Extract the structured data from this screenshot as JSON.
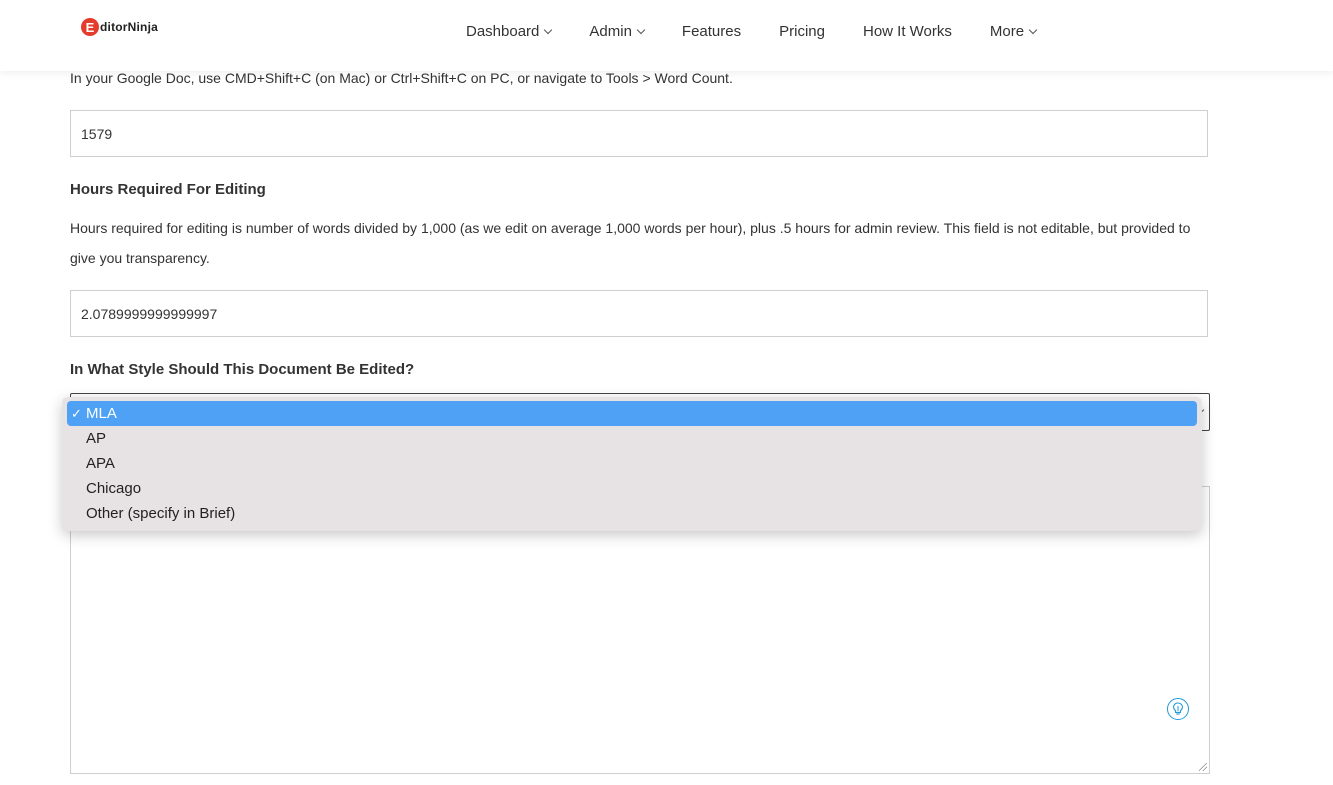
{
  "logo": {
    "mark": "E",
    "text": "ditorNinja"
  },
  "nav": {
    "items": [
      {
        "label": "Dashboard",
        "has_dropdown": true
      },
      {
        "label": "Admin",
        "has_dropdown": true
      },
      {
        "label": "Features",
        "has_dropdown": false
      },
      {
        "label": "Pricing",
        "has_dropdown": false
      },
      {
        "label": "How It Works",
        "has_dropdown": false
      },
      {
        "label": "More",
        "has_dropdown": true
      }
    ]
  },
  "form": {
    "word_count_hint": "In your Google Doc, use CMD+Shift+C (on Mac) or Ctrl+Shift+C on PC, or navigate to Tools > Word Count.",
    "word_count_value": "1579",
    "hours_label": "Hours Required For Editing",
    "hours_hint": "Hours required for editing is number of words divided by 1,000 (as we edit on average 1,000 words per hour), plus .5 hours for admin review. This field is not editable, but provided to give you transparency.",
    "hours_value": "2.0789999999999997",
    "style_label": "In What Style Should This Document Be Edited?",
    "style_selected": "MLA",
    "style_options": [
      "MLA",
      "AP",
      "APA",
      "Chicago",
      "Other (specify in Brief)"
    ],
    "check_mark": "✓"
  },
  "colors": {
    "accent_selected": "#4ea1f5",
    "dropdown_bg": "#e7e2e4",
    "logo_red": "#e53b2c",
    "assist_icon": "#1e9bd7"
  },
  "icons": {
    "assist": "lightbulb-assist-icon",
    "chevron": "chevron-down-icon",
    "check": "check-icon"
  }
}
